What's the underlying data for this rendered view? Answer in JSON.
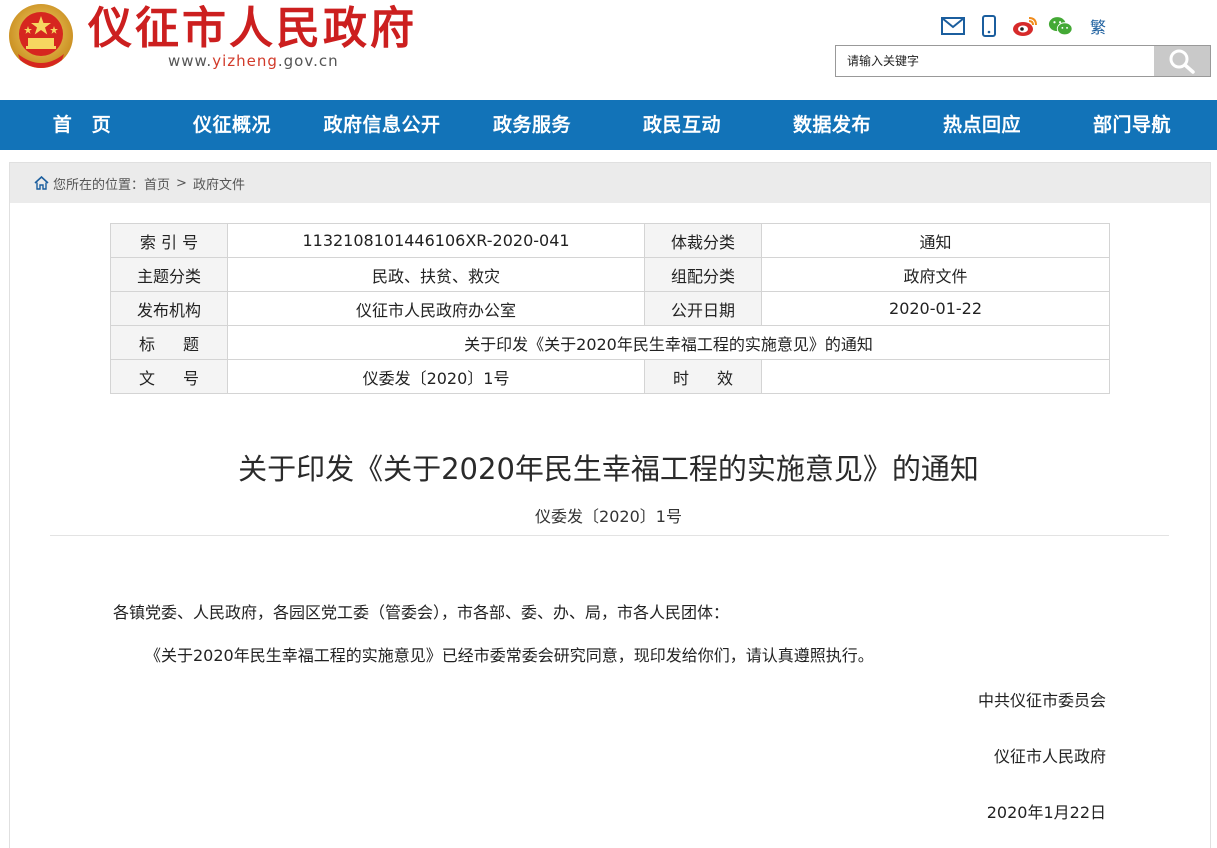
{
  "header": {
    "site_title": "仪征市人民政府",
    "url_prefix": "www.",
    "url_highlight": "yizheng",
    "url_suffix": ".gov.cn",
    "icons": [
      "mail-icon",
      "mobile-icon",
      "weibo-icon",
      "wechat-icon"
    ],
    "traditional_label": "繁",
    "search_placeholder": "请输入关键字"
  },
  "nav": {
    "items": [
      {
        "label": "首　页"
      },
      {
        "label": "仪征概况"
      },
      {
        "label": "政府信息公开"
      },
      {
        "label": "政务服务"
      },
      {
        "label": "政民互动"
      },
      {
        "label": "数据发布"
      },
      {
        "label": "热点回应"
      },
      {
        "label": "部门导航"
      }
    ]
  },
  "breadcrumb": {
    "prefix": "您所在的位置：",
    "items": [
      "首页",
      "政府文件"
    ],
    "separator": ">"
  },
  "meta": {
    "index_label": "索 引 号",
    "index_value": "1132108101446106XR-2020-041",
    "genre_label": "体裁分类",
    "genre_value": "通知",
    "topic_label": "主题分类",
    "topic_value": "民政、扶贫、救灾",
    "group_label": "组配分类",
    "group_value": "政府文件",
    "issuer_label": "发布机构",
    "issuer_value": "仪征市人民政府办公室",
    "date_label": "公开日期",
    "date_value": "2020-01-22",
    "title_label": "标题",
    "title_value": "关于印发《关于2020年民生幸福工程的实施意见》的通知",
    "docno_label": "文号",
    "docno_value": "仪委发〔2020〕1号",
    "validity_label": "时效",
    "validity_value": ""
  },
  "article": {
    "title": "关于印发《关于2020年民生幸福工程的实施意见》的通知",
    "doc_number": "仪委发〔2020〕1号",
    "salutation": "各镇党委、人民政府，各园区党工委（管委会），市各部、委、办、局，市各人民团体：",
    "body": "《关于2020年民生幸福工程的实施意见》已经市委常委会研究同意，现印发给你们，请认真遵照执行。",
    "signature_1": "中共仪征市委员会",
    "signature_2": "仪征市人民政府",
    "date": "2020年1月22日"
  },
  "colors": {
    "brand_red": "#cc1f1f",
    "nav_blue": "#1273b8",
    "breadcrumb_bg": "#ebebeb"
  }
}
